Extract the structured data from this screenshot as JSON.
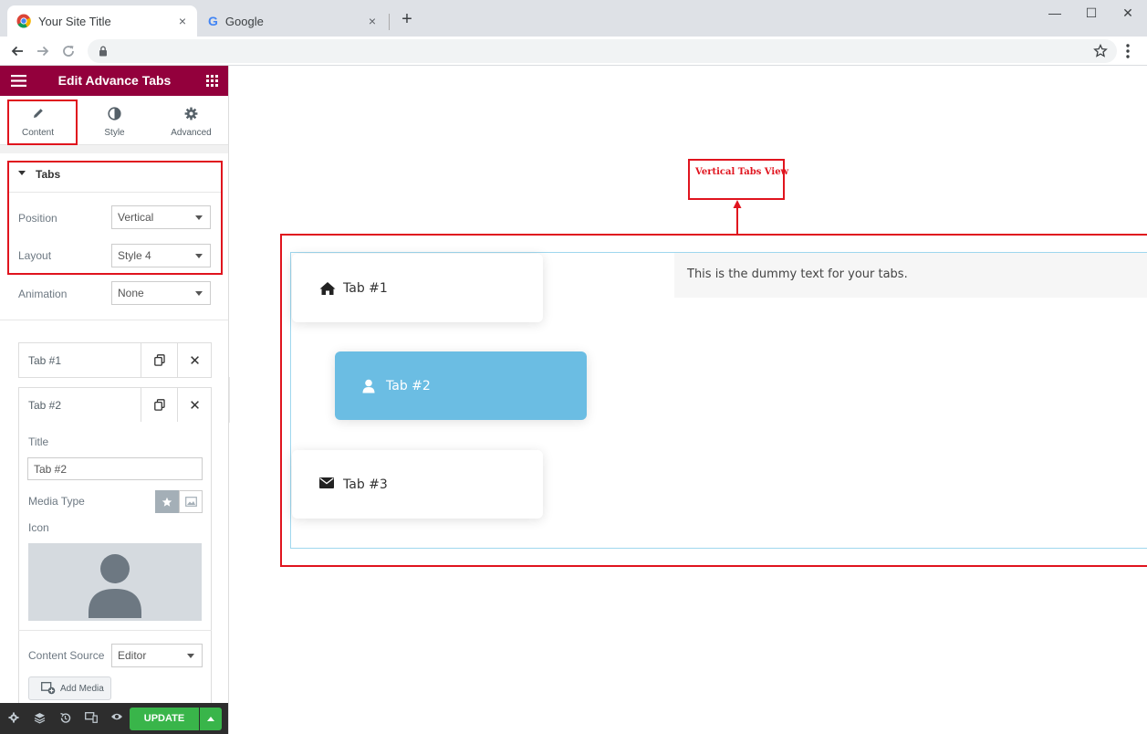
{
  "browser": {
    "tabs": [
      {
        "title": "Your Site Title",
        "close": "×"
      },
      {
        "title": "Google",
        "close": "×"
      }
    ],
    "new_tab": "+",
    "win_min": "—",
    "win_max": "☐",
    "win_close": "✕"
  },
  "panel": {
    "title": "Edit Advance Tabs",
    "tabs": [
      {
        "label": "Content"
      },
      {
        "label": "Style"
      },
      {
        "label": "Advanced"
      }
    ],
    "section": {
      "title": "Tabs",
      "position_label": "Position",
      "position_value": "Vertical",
      "layout_label": "Layout",
      "layout_value": "Style 4",
      "animation_label": "Animation",
      "animation_value": "None"
    },
    "items": [
      {
        "label": "Tab #1"
      },
      {
        "label": "Tab #2"
      }
    ],
    "item_close": "✕",
    "item_editor": {
      "title_label": "Title",
      "title_value": "Tab #2",
      "media_type_label": "Media Type",
      "icon_label": "Icon",
      "content_source_label": "Content Source",
      "content_source_value": "Editor",
      "add_media_label": "Add Media"
    },
    "update_label": "UPDATE"
  },
  "preview": {
    "annotation": "Vertical Tabs View",
    "tabs": [
      {
        "label": "Tab #1",
        "icon": "home-icon",
        "active": false
      },
      {
        "label": "Tab #2",
        "icon": "user-icon",
        "active": true
      },
      {
        "label": "Tab #3",
        "icon": "envelope-icon",
        "active": false
      }
    ],
    "content_text": "This is the dummy text for your tabs."
  },
  "colors": {
    "brand": "#93003c",
    "active_tab": "#6bbde3",
    "highlight": "#e0141e",
    "update_button": "#39b54a"
  }
}
